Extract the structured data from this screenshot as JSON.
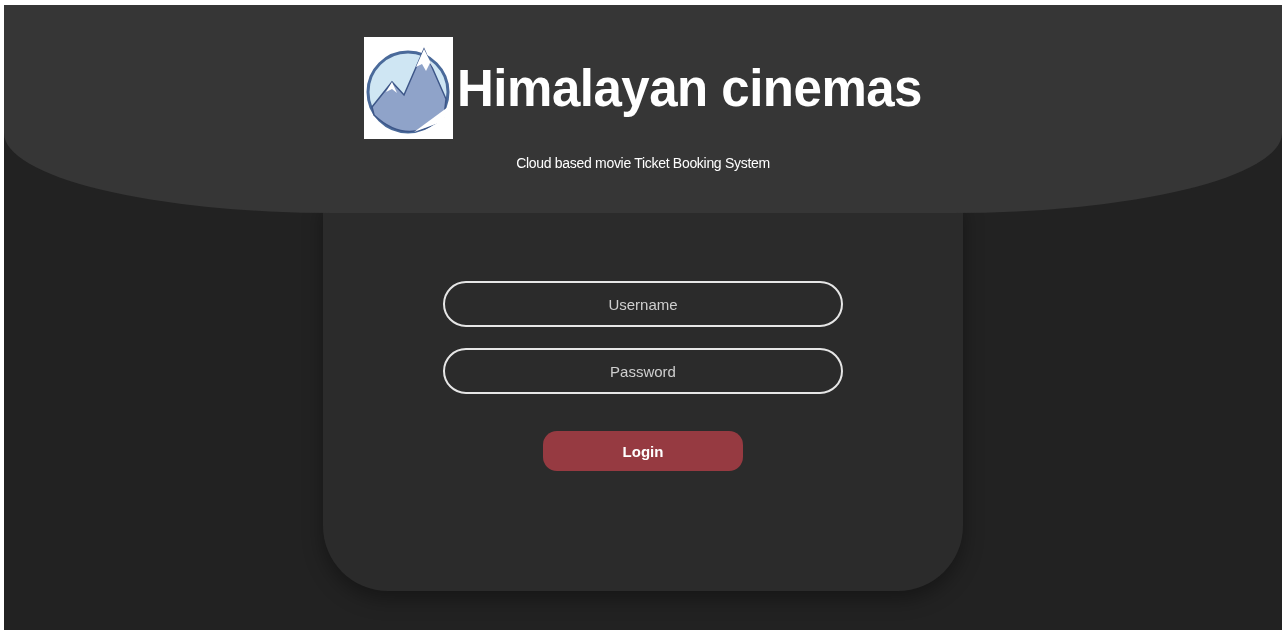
{
  "header": {
    "title": "Himalayan cinemas",
    "subtitle": "Cloud based movie Ticket Booking System"
  },
  "form": {
    "fields": [
      {
        "placeholder": "Username"
      },
      {
        "placeholder": "Password"
      }
    ],
    "button": "Login"
  }
}
